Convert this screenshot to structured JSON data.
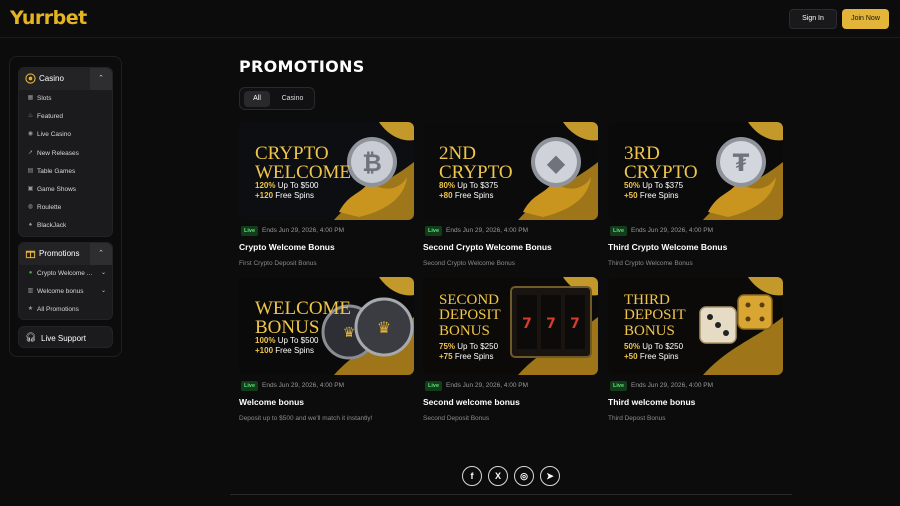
{
  "header": {
    "logo": "Yurrbet",
    "sign_in": "Sign In",
    "join_now": "Join Now"
  },
  "sidebar": {
    "casino": {
      "label": "Casino",
      "items": [
        {
          "label": "Slots",
          "icon": "slots-icon"
        },
        {
          "label": "Featured",
          "icon": "flame-icon"
        },
        {
          "label": "Live Casino",
          "icon": "live-icon"
        },
        {
          "label": "New Releases",
          "icon": "rocket-icon"
        },
        {
          "label": "Table Games",
          "icon": "cards-icon"
        },
        {
          "label": "Game Shows",
          "icon": "tv-icon"
        },
        {
          "label": "Roulette",
          "icon": "roulette-icon"
        },
        {
          "label": "BlackJack",
          "icon": "spade-icon"
        }
      ]
    },
    "promotions": {
      "label": "Promotions",
      "items": [
        {
          "label": "Crypto Welcome ...",
          "icon": "crypto-icon"
        },
        {
          "label": "Welcome bonus",
          "icon": "gift-icon"
        },
        {
          "label": "All Promotions",
          "icon": "star-icon"
        }
      ]
    },
    "live_support": "Live Support"
  },
  "main": {
    "title": "PROMOTIONS",
    "tabs": [
      "All",
      "Casino"
    ],
    "active_tab": "All",
    "cards": [
      {
        "head1": "CRYPTO",
        "head2": "WELCOME",
        "pct": "120%",
        "offer": "Up To $500",
        "spins": "+120",
        "spins_label": "Free Spins",
        "coin": "B",
        "badge": "Live",
        "ends": "Ends Jun 29, 2026, 4:00 PM",
        "title": "Crypto Welcome Bonus",
        "subtitle": "First Crypto Deposit Bonus"
      },
      {
        "head1": "2ND",
        "head2": "CRYPTO",
        "pct": "80%",
        "offer": "Up To $375",
        "spins": "+80",
        "spins_label": "Free Spins",
        "coin": "E",
        "badge": "Live",
        "ends": "Ends Jun 29, 2026, 4:00 PM",
        "title": "Second Crypto Welcome Bonus",
        "subtitle": "Second Crypto Welcome Bonus"
      },
      {
        "head1": "3RD",
        "head2": "CRYPTO",
        "pct": "50%",
        "offer": "Up To $375",
        "spins": "+50",
        "spins_label": "Free Spins",
        "coin": "T",
        "badge": "Live",
        "ends": "Ends Jun 29, 2026, 4:00 PM",
        "title": "Third Crypto Welcome Bonus",
        "subtitle": "Third Crypto Welcome Bonus"
      },
      {
        "head1": "WELCOME",
        "head2": "BONUS",
        "pct": "100%",
        "offer": "Up To $500",
        "spins": "+100",
        "spins_label": "Free Spins",
        "coin": "",
        "badge": "Live",
        "ends": "Ends Jun 29, 2026, 4:00 PM",
        "title": "Welcome bonus",
        "subtitle": "Deposit up to $500 and we'll match it instantly!"
      },
      {
        "head1": "SECOND",
        "head2": "DEPOSIT",
        "head3": "BONUS",
        "pct": "75%",
        "offer": "Up To $250",
        "spins": "+75",
        "spins_label": "Free Spins",
        "coin": "",
        "badge": "Live",
        "ends": "Ends Jun 29, 2026, 4:00 PM",
        "title": "Second welcome bonus",
        "subtitle": "Second Deposit Bonus"
      },
      {
        "head1": "THIRD",
        "head2": "DEPOSIT",
        "head3": "BONUS",
        "pct": "50%",
        "offer": "Up To $250",
        "spins": "+50",
        "spins_label": "Free Spins",
        "coin": "",
        "badge": "Live",
        "ends": "Ends Jun 29, 2026, 4:00 PM",
        "title": "Third welcome bonus",
        "subtitle": "Third Depost Bonus"
      }
    ]
  },
  "footer": {
    "social": [
      {
        "icon": "facebook-icon",
        "glyph": "f"
      },
      {
        "icon": "x-icon",
        "glyph": "X"
      },
      {
        "icon": "instagram-icon",
        "glyph": "◎"
      },
      {
        "icon": "telegram-icon",
        "glyph": "➤"
      }
    ]
  },
  "colors": {
    "accent": "#e2b43a",
    "gold_text": "#f0c64a",
    "live_badge": "#123d1b"
  }
}
